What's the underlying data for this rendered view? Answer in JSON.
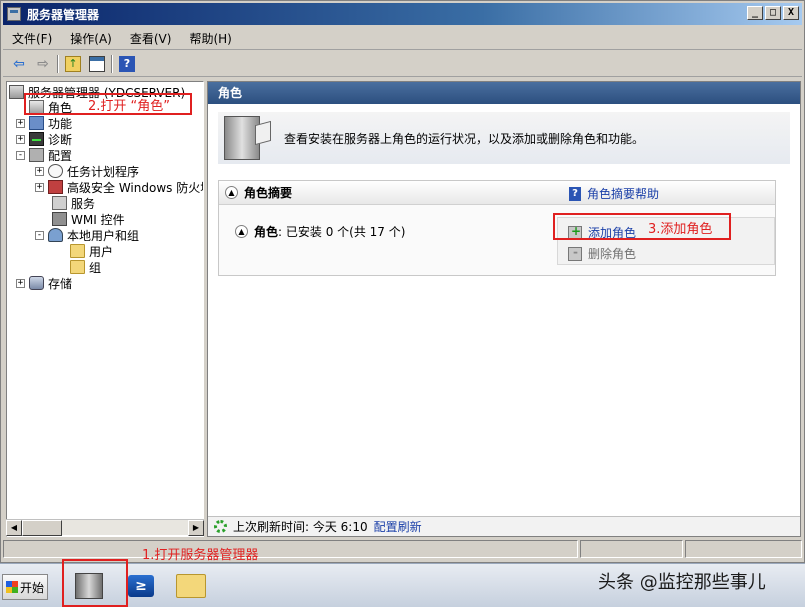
{
  "window": {
    "title": "服务器管理器",
    "controls": {
      "minimize": "_",
      "restore": "□",
      "close": "X"
    }
  },
  "menubar": {
    "items": [
      {
        "label": "文件(F)"
      },
      {
        "label": "操作(A)"
      },
      {
        "label": "查看(V)"
      },
      {
        "label": "帮助(H)"
      }
    ]
  },
  "toolbar": {
    "icons": [
      "back-arrow-icon",
      "forward-arrow-icon",
      "up-folder-icon",
      "show-hide-pane-icon",
      "help-icon"
    ],
    "help_glyph": "?",
    "back_glyph": "⇦",
    "forward_glyph": "⇨",
    "up_glyph": "↑"
  },
  "tree": {
    "items": [
      {
        "label": "服务器管理器 (YDCSERVER)",
        "level": 0,
        "icon": "server-manager-icon"
      },
      {
        "label": "角色",
        "level": 1,
        "icon": "roles-icon",
        "selected": true
      },
      {
        "label": "功能",
        "level": 1,
        "icon": "features-icon",
        "expander": "+"
      },
      {
        "label": "诊断",
        "level": 1,
        "icon": "diagnostics-icon",
        "expander": "+"
      },
      {
        "label": "配置",
        "level": 1,
        "icon": "configuration-icon",
        "expander": "-"
      },
      {
        "label": "任务计划程序",
        "level": 2,
        "icon": "task-scheduler-icon",
        "expander": "+"
      },
      {
        "label": "高级安全 Windows 防火墙",
        "level": 2,
        "icon": "firewall-icon",
        "expander": "+"
      },
      {
        "label": "服务",
        "level": 2,
        "icon": "services-icon"
      },
      {
        "label": "WMI 控件",
        "level": 2,
        "icon": "wmi-control-icon"
      },
      {
        "label": "本地用户和组",
        "level": 2,
        "icon": "local-users-icon",
        "expander": "-"
      },
      {
        "label": "用户",
        "level": 3,
        "icon": "folder-icon"
      },
      {
        "label": "组",
        "level": 3,
        "icon": "folder-icon"
      },
      {
        "label": "存储",
        "level": 1,
        "icon": "storage-icon",
        "expander": "+"
      }
    ],
    "scroll_left": "◀",
    "scroll_right": "▶"
  },
  "content": {
    "header": "角色",
    "intro": "查看安装在服务器上角色的运行状况，以及添加或删除角色和功能。",
    "summary": {
      "title": "角色摘要",
      "help_label": "角色摘要帮助",
      "roles_label": "角色",
      "roles_status": ": 已安装 0 个(共 17 个)",
      "add_roles": "添加角色",
      "remove_roles": "删除角色"
    },
    "refresh": {
      "label": "上次刷新时间: 今天 6:10",
      "link": "配置刷新"
    }
  },
  "annotations": {
    "step1": "1.打开服务器管理器",
    "step2": "2.打开 “角色”",
    "step3": "3.添加角色"
  },
  "taskbar": {
    "start_label": "开始",
    "powershell_glyph": "≥",
    "watermark": "头条 @监控那些事儿"
  },
  "colors": {
    "title_bar": "#0a246a",
    "content_header": "#3a5f8f",
    "link": "#1a3fa8",
    "annotation": "#e02020"
  }
}
